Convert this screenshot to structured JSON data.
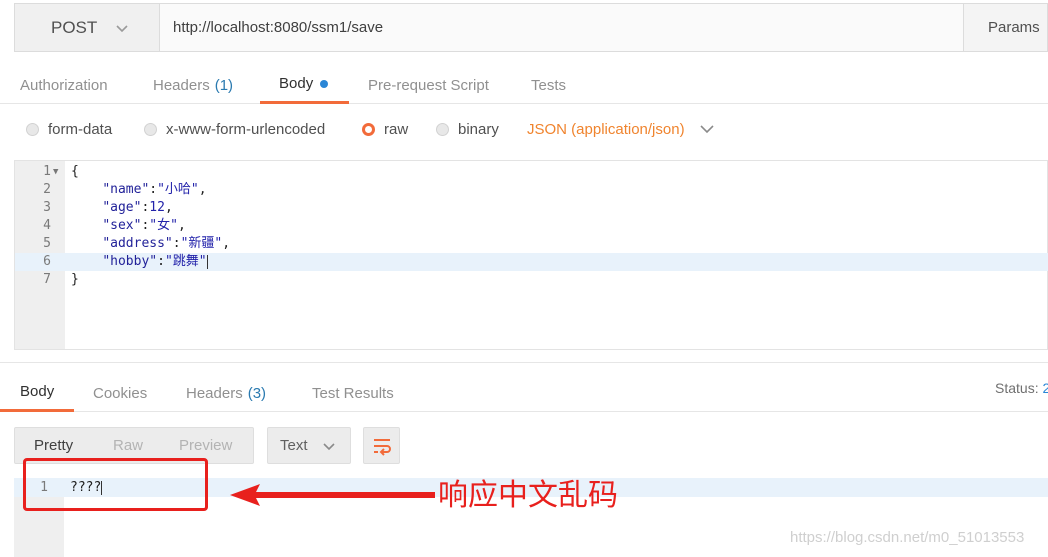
{
  "request": {
    "method": "POST",
    "url": "http://localhost:8080/ssm1/save",
    "params_label": "Params"
  },
  "request_tabs": {
    "authorization": "Authorization",
    "headers": "Headers",
    "headers_count": "(1)",
    "body": "Body",
    "prerequest": "Pre-request Script",
    "tests": "Tests"
  },
  "body_types": {
    "form_data": "form-data",
    "urlencoded": "x-www-form-urlencoded",
    "raw": "raw",
    "binary": "binary",
    "selected": "raw",
    "content_type": "JSON (application/json)"
  },
  "editor": {
    "lines": [
      {
        "n": "1",
        "text": "{"
      },
      {
        "n": "2",
        "key": "\"name\"",
        "value": "\"小哈\"",
        "tail": ","
      },
      {
        "n": "3",
        "key": "\"age\"",
        "value": "12",
        "tail": ","
      },
      {
        "n": "4",
        "key": "\"sex\"",
        "value": "\"女\"",
        "tail": ","
      },
      {
        "n": "5",
        "key": "\"address\"",
        "value": "\"新疆\"",
        "tail": ","
      },
      {
        "n": "6",
        "key": "\"hobby\"",
        "value": "\"跳舞\"",
        "tail": ""
      },
      {
        "n": "7",
        "text": "}"
      }
    ]
  },
  "response_tabs": {
    "body": "Body",
    "cookies": "Cookies",
    "headers": "Headers",
    "headers_count": "(3)",
    "test_results": "Test Results",
    "status_label": "Status:",
    "status_value": "2"
  },
  "response_view": {
    "pretty": "Pretty",
    "raw": "Raw",
    "preview": "Preview",
    "format": "Text"
  },
  "response_body": {
    "line_number": "1",
    "text": "????"
  },
  "annotation": {
    "text": "响应中文乱码"
  },
  "watermark": "https://blog.csdn.net/m0_51013553",
  "colors": {
    "accent": "#f26b3a",
    "annotation_red": "#e8201d",
    "link_blue": "#2a7ab0"
  }
}
